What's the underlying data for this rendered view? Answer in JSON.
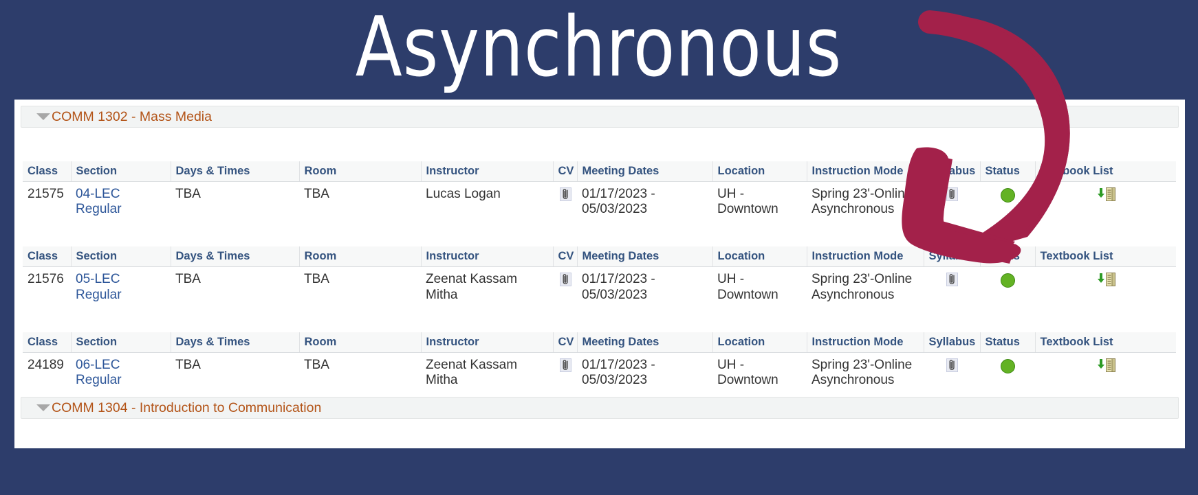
{
  "banner": {
    "title": "Asynchronous",
    "background_color": "#2d3d6b",
    "text_color": "#ffffff"
  },
  "annotation": {
    "shape": "curved-down-left-arrow",
    "color": "#a3214a"
  },
  "groups": [
    {
      "id": "comm-1302",
      "title": "COMM 1302 - Mass Media",
      "expanded": true,
      "toggle_icon": "triangle-down-icon",
      "color": "#b35418"
    },
    {
      "id": "comm-1304",
      "title": "COMM 1304 - Introduction to Communication",
      "expanded": true,
      "toggle_icon": "triangle-down-icon",
      "color": "#b35418"
    }
  ],
  "table": {
    "headers": [
      "Class",
      "Section",
      "Days & Times",
      "Room",
      "Instructor",
      "CV",
      "Meeting Dates",
      "Location",
      "Instruction Mode",
      "Syllabus",
      "Status",
      "Textbook List"
    ],
    "header_color": "#34537f"
  },
  "sections": [
    {
      "class_nbr": "21575",
      "section": "04-LEC Regular",
      "days_times": "TBA",
      "room": "TBA",
      "instructor": "Lucas Logan",
      "cv_icon": "paperclip-icon",
      "meeting_dates": "01/17/2023 - 05/03/2023",
      "location": "UH - Downtown",
      "instruction_mode": "Spring 23'-Online Asynchronous",
      "syllabus_icon": "paperclip-icon",
      "status_icon": "green-circle-open-status-icon",
      "status_color": "#63b224",
      "textbook_icon": "download-textbook-list-icon"
    },
    {
      "class_nbr": "21576",
      "section": "05-LEC Regular",
      "days_times": "TBA",
      "room": "TBA",
      "instructor": "Zeenat Kassam Mitha",
      "cv_icon": "paperclip-icon",
      "meeting_dates": "01/17/2023 - 05/03/2023",
      "location": "UH - Downtown",
      "instruction_mode": "Spring 23'-Online Asynchronous",
      "syllabus_icon": "paperclip-icon",
      "status_icon": "green-circle-open-status-icon",
      "status_color": "#63b224",
      "textbook_icon": "download-textbook-list-icon"
    },
    {
      "class_nbr": "24189",
      "section": "06-LEC Regular",
      "days_times": "TBA",
      "room": "TBA",
      "instructor": "Zeenat Kassam Mitha",
      "cv_icon": "paperclip-icon",
      "meeting_dates": "01/17/2023 - 05/03/2023",
      "location": "UH - Downtown",
      "instruction_mode": "Spring 23'-Online Asynchronous",
      "syllabus_icon": "paperclip-icon",
      "status_icon": "green-circle-open-status-icon",
      "status_color": "#63b224",
      "textbook_icon": "download-textbook-list-icon"
    }
  ]
}
